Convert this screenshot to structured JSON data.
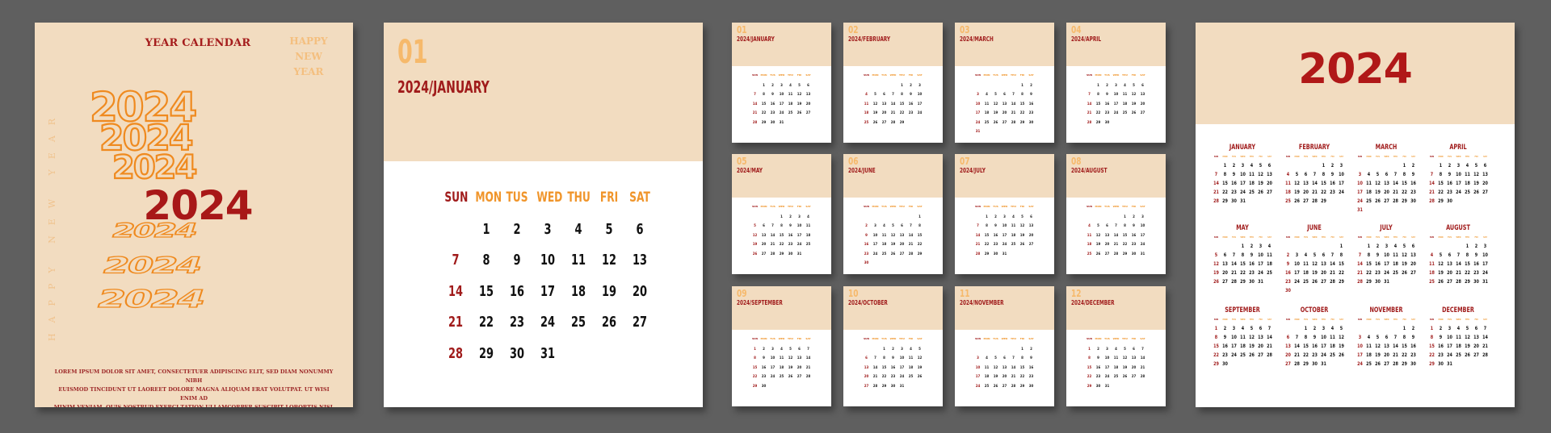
{
  "colors": {
    "background": "#5f5f5f",
    "cream": "#f2dcc0",
    "dark_red": "#a01b1b",
    "orange": "#f0952b",
    "light_orange": "#f6b96b"
  },
  "cover": {
    "title": "YEAR CALENDAR",
    "corner_text": [
      "HAPPY",
      "NEW",
      "YEAR"
    ],
    "vertical_text": "HAPPY NEW YEAR",
    "outline_year": "2024",
    "main_year": "2024",
    "lorem_lines": [
      "Lorem ipsum dolor sit amet, consectetuer adipiscing elit, sed diam nonummy nibh",
      "euismod tincidunt ut laoreet dolore magna aliquam erat volutpat. Ut wisi enim ad",
      "minim veniam, quis nostrud exerci tation ullamcorper suscipit lobortis nisl ut aliquip"
    ]
  },
  "weekday_headers": [
    "SUN",
    "MON",
    "TUS",
    "WED",
    "THU",
    "FRI",
    "SAT"
  ],
  "weekday_headers_short": [
    "SUN",
    "MON",
    "TUS",
    "WED",
    "THU",
    "FRI",
    "SAT"
  ],
  "january_page": {
    "month_number": "01",
    "title": "2024/JANUARY"
  },
  "year": "2024",
  "months": [
    {
      "num": "01",
      "name": "JANUARY",
      "card_title": "2024/JANUARY",
      "start": 1,
      "days": 31
    },
    {
      "num": "02",
      "name": "FEBRUARY",
      "card_title": "2024/FEBRUARY",
      "start": 4,
      "days": 29
    },
    {
      "num": "03",
      "name": "MARCH",
      "card_title": "2024/MARCH",
      "start": 5,
      "days": 31
    },
    {
      "num": "04",
      "name": "APRIL",
      "card_title": "2024/APRIL",
      "start": 1,
      "days": 30
    },
    {
      "num": "05",
      "name": "MAY",
      "card_title": "2024/MAY",
      "start": 3,
      "days": 31
    },
    {
      "num": "06",
      "name": "JUNE",
      "card_title": "2024/JUNE",
      "start": 6,
      "days": 30
    },
    {
      "num": "07",
      "name": "JULY",
      "card_title": "2024/JULY",
      "start": 1,
      "days": 31
    },
    {
      "num": "08",
      "name": "AUGUST",
      "card_title": "2024/AUGUST",
      "start": 4,
      "days": 31
    },
    {
      "num": "09",
      "name": "SEPTEMBER",
      "card_title": "2024/SEPTEMBER",
      "start": 0,
      "days": 30
    },
    {
      "num": "10",
      "name": "OCTOBER",
      "card_title": "2024/OCTOBER",
      "start": 2,
      "days": 31
    },
    {
      "num": "11",
      "name": "NOVEMBER",
      "card_title": "2024/NOVEMBER",
      "start": 5,
      "days": 30
    },
    {
      "num": "12",
      "name": "DECEMBER",
      "card_title": "2024/DECEMBER",
      "start": 0,
      "days": 31
    }
  ]
}
